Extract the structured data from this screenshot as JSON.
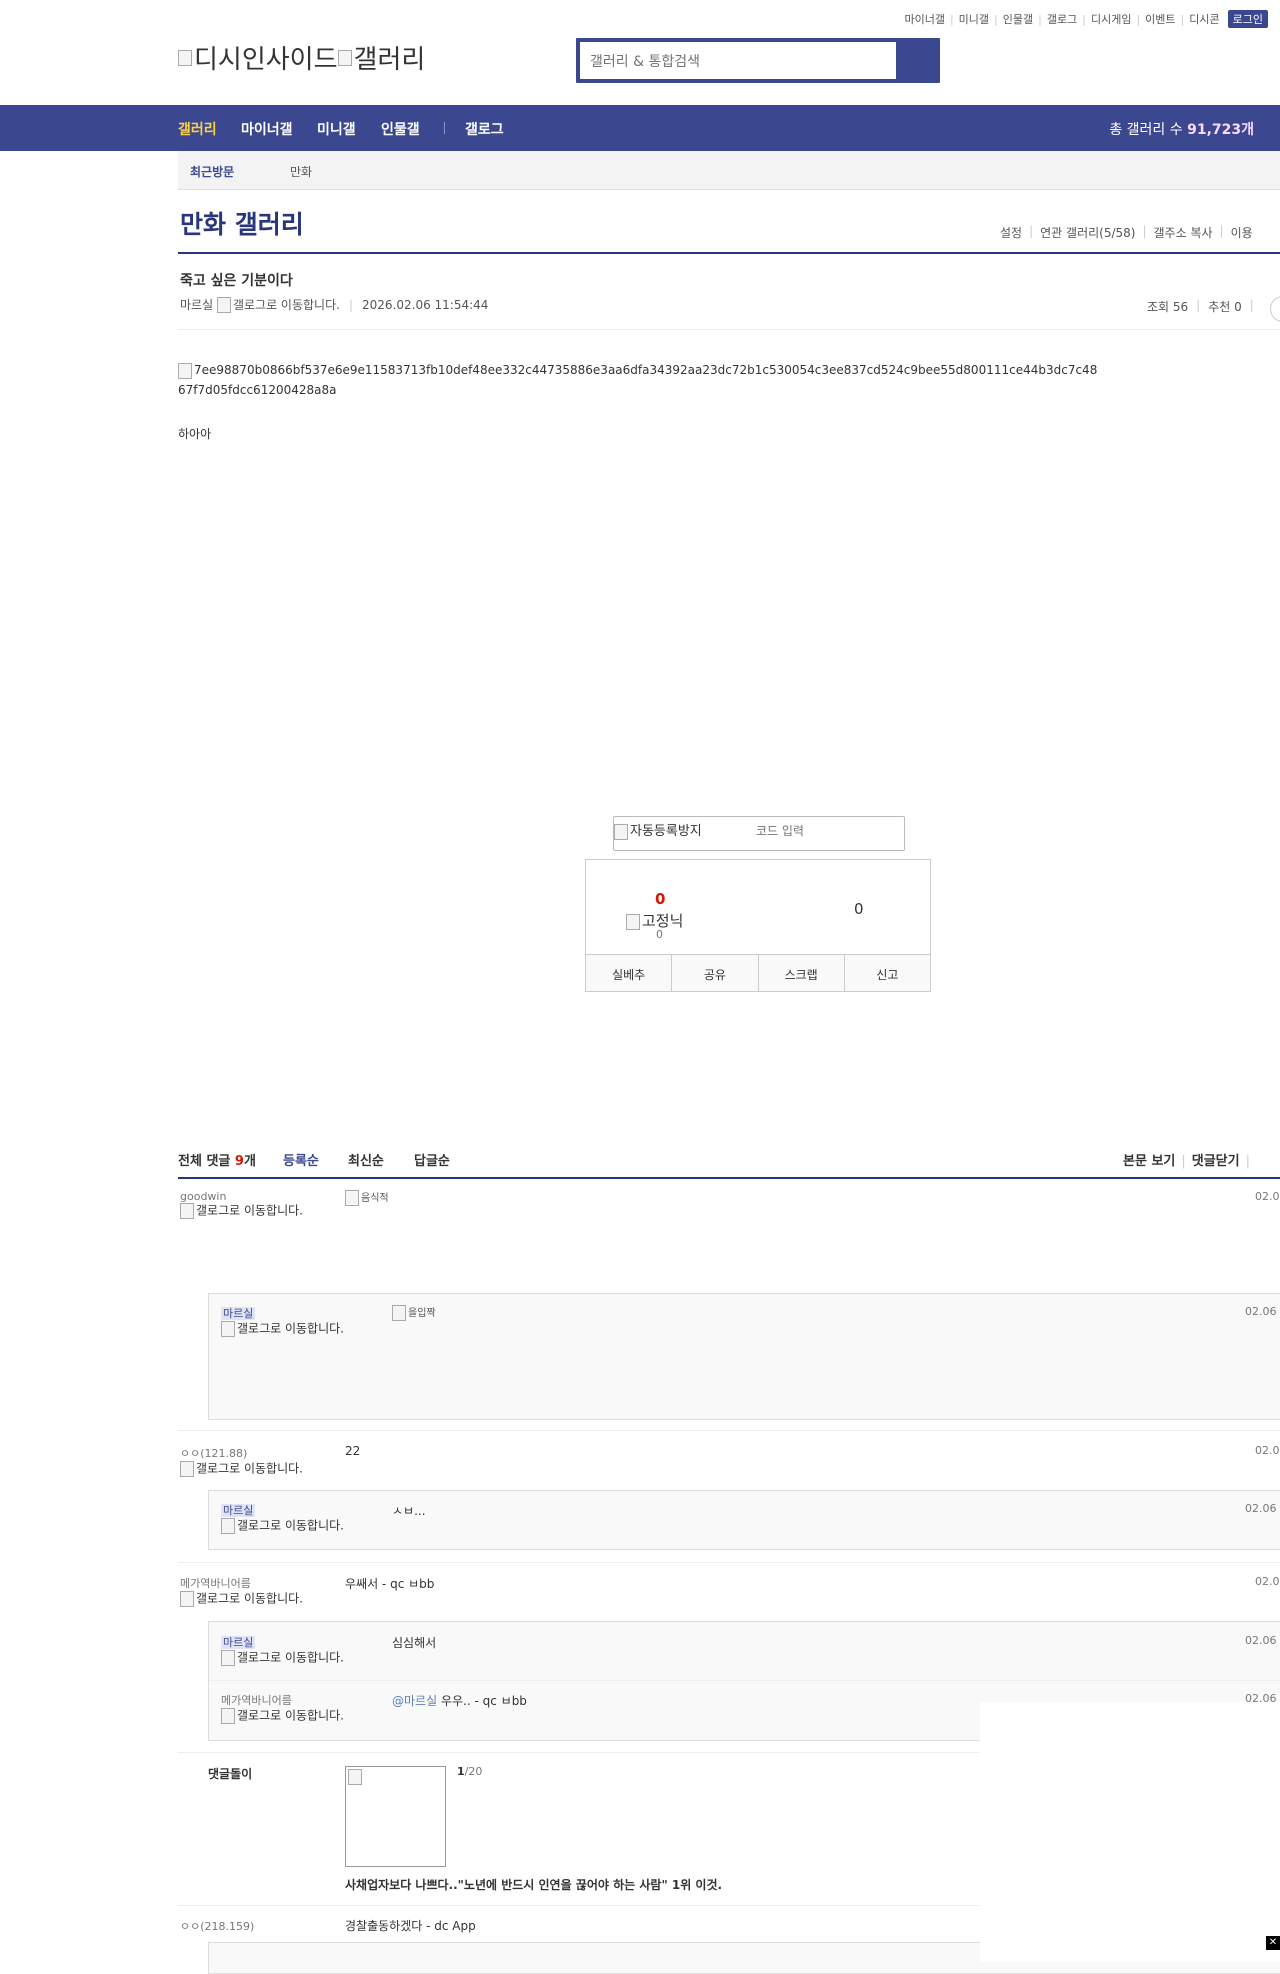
{
  "top_links": [
    "마이너갤",
    "미니갤",
    "인물갤",
    "갤로그",
    "디시게임",
    "이벤트",
    "디시콘"
  ],
  "login_label": "로그인",
  "logo": {
    "alt1": "디시인사이드",
    "alt2": "갤러리"
  },
  "search": {
    "placeholder": "갤러리 & 통합검색"
  },
  "nav": {
    "items": [
      "갤러리",
      "마이너갤",
      "미니갤",
      "인물갤",
      "갤로그"
    ],
    "total_label": "총 갤러리 수",
    "total_value": "91,723개"
  },
  "recent": {
    "title": "최근방문",
    "gallery": "만화"
  },
  "gallery_title": "만화 갤러리",
  "gallery_menu": [
    "설정",
    "연관 갤러리(5/58)",
    "갤주소 복사",
    "이용"
  ],
  "post": {
    "title": "죽고 싶은 기분이다",
    "author": "마르실",
    "gallog_alt": "갤로그로 이동합니다.",
    "date": "2026.02.06 11:54:44",
    "views": "조회 56",
    "recommends": "추천 0",
    "image_alt": "7ee98870b0866bf537e6e9e11583713fb10def48ee332c44735886e3aa6dfa34392aa23dc72b1c530054c3ee837cd524c9bee55d800111ce44b3dc7c4867f7d05fdcc61200428a8a",
    "body": "하아아"
  },
  "captcha": {
    "alt": "자동등록방지",
    "placeholder": "코드 입력"
  },
  "vote": {
    "up": "0",
    "fixed_alt": "고정닉",
    "fixed_count": "0",
    "down": "0",
    "buttons": [
      "실베추",
      "공유",
      "스크랩",
      "신고"
    ]
  },
  "comments_header": {
    "total_label": "전체 댓글",
    "count": "9",
    "unit": "개",
    "sort": [
      "등록순",
      "최신순",
      "답글순"
    ],
    "right": [
      "본문 보기",
      "댓글닫기"
    ]
  },
  "gallog_alt": "갤로그로 이동합니다.",
  "comments": [
    {
      "nick": "goodwin",
      "content_alt": "음식적",
      "date": "02.0"
    },
    {
      "nick": "마르실",
      "content_alt": "을입짝",
      "date": "02.06"
    },
    {
      "nick": "ㅇㅇ",
      "ip": "(121.88)",
      "text": "22",
      "date": "02.0"
    },
    {
      "nick": "마르실",
      "text": "ㅅㅂ...",
      "date": "02.06"
    },
    {
      "nick": "메가역바니어름",
      "text": "우쌔서 - qc ㅂbb",
      "date": "02.0"
    },
    {
      "nick": "마르실",
      "text": "심심해서",
      "date": "02.06"
    },
    {
      "nick": "메가역바니어름",
      "mention": "@마르실",
      "text": "우우.. - qc ㅂbb",
      "date": "02.06"
    }
  ],
  "bot": {
    "title": "댓글돌이",
    "page_current": "1",
    "page_total": "/20",
    "headline": "사채업자보다 나쁘다..\"노년에 반드시 인연을 끊어야 하는 사람\" 1위 이것."
  },
  "last_comment": {
    "nick": "ㅇㅇ",
    "ip": "(218.159)",
    "text": "경찰출동하겠다 - dc App"
  }
}
